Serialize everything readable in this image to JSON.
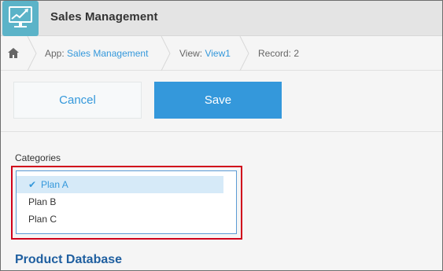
{
  "header": {
    "title": "Sales Management",
    "app_icon": "trend-chart-monitor-icon"
  },
  "breadcrumb": {
    "home_icon": "home-icon",
    "app_prefix": "App: ",
    "app_link": "Sales Management",
    "view_prefix": "View: ",
    "view_link": "View1",
    "record": "Record: 2"
  },
  "toolbar": {
    "cancel_label": "Cancel",
    "save_label": "Save"
  },
  "form": {
    "categories_label": "Categories",
    "options": [
      {
        "label": "Plan A",
        "selected": true
      },
      {
        "label": "Plan B",
        "selected": false
      },
      {
        "label": "Plan C",
        "selected": false
      }
    ],
    "section_title": "Product Database"
  },
  "colors": {
    "accent": "#3498db",
    "highlight": "#d0021b",
    "header_bg": "#e4e4e4",
    "section_title": "#1f5fa0"
  }
}
